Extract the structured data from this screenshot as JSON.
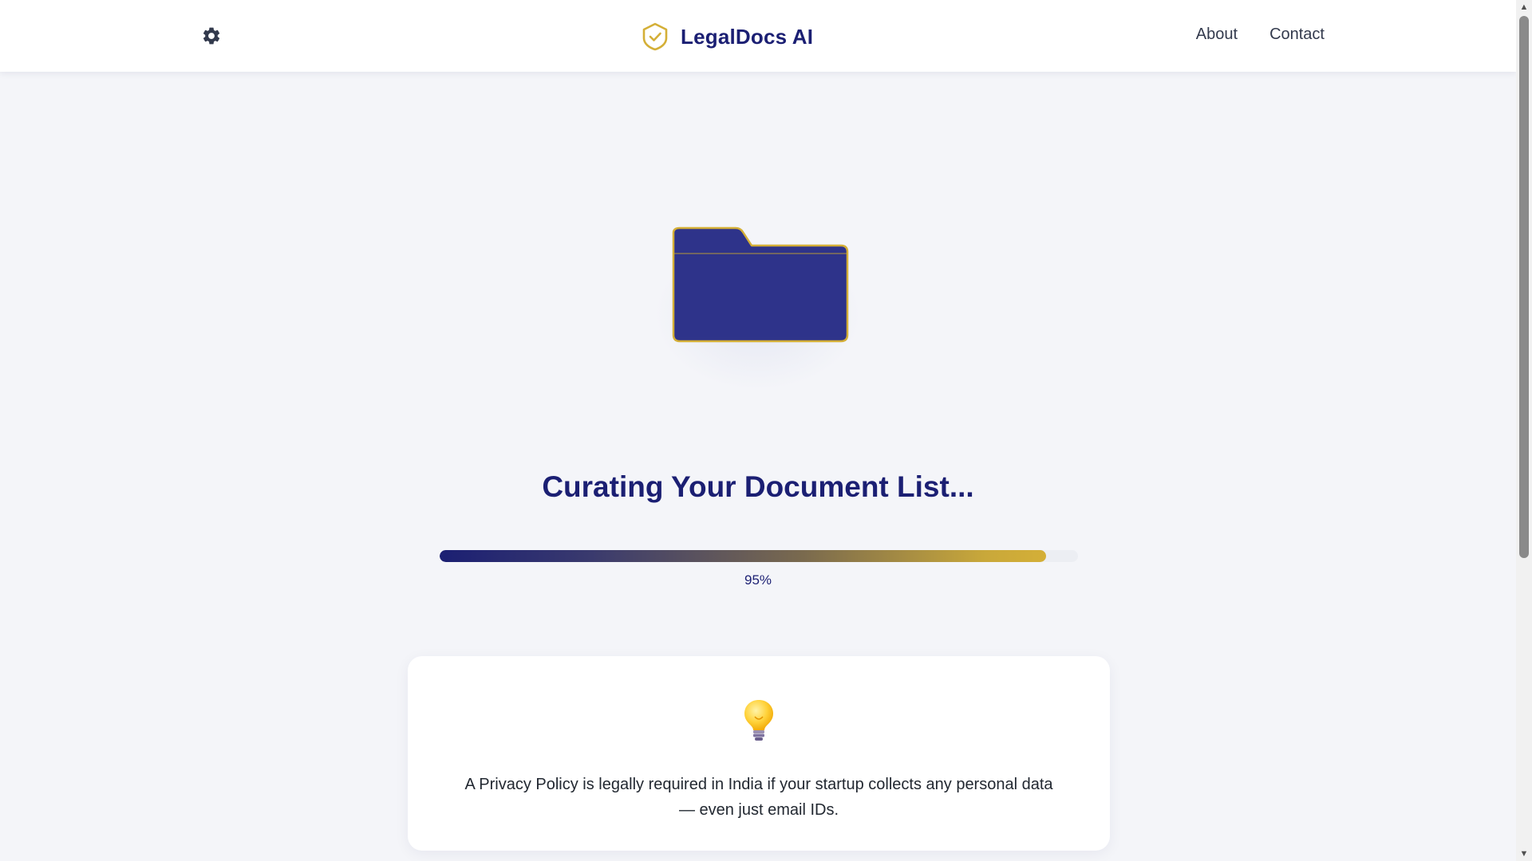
{
  "header": {
    "brand_name": "LegalDocs AI",
    "brand_icon": "shield-check-icon",
    "settings_icon": "gear-icon",
    "nav": [
      {
        "label": "About"
      },
      {
        "label": "Contact"
      }
    ]
  },
  "loading": {
    "illustration_icon": "folder-icon",
    "title": "Curating Your Document List...",
    "progress_value": 0.95,
    "progress_label": "95%"
  },
  "tip": {
    "icon": "lightbulb-icon",
    "text": "A Privacy Policy is legally required in India if your startup collects any personal data — even just email IDs."
  },
  "colors": {
    "brand_navy": "#1b1f73",
    "accent_gold": "#d4af37",
    "folder_fill": "#2e338a",
    "page_background": "#f4f5f9"
  }
}
